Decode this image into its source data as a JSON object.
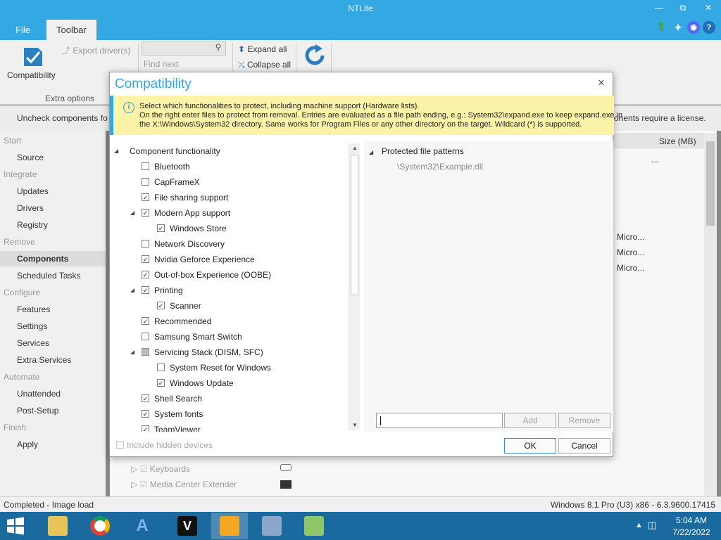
{
  "window": {
    "title": "NTLite"
  },
  "menu": {
    "file": "File",
    "toolbar": "Toolbar"
  },
  "ribbon": {
    "compatibility": "Compatibility",
    "export_drivers": "Export driver(s)",
    "find_next": "Find next",
    "expand_all": "Expand all",
    "collapse_all": "Collapse all",
    "extra_options": "Extra options"
  },
  "infobar": {
    "left": "Uncheck components fo",
    "right": "onents require a license."
  },
  "sidebar": {
    "sections": [
      {
        "label": "Start",
        "items": [
          "Source"
        ]
      },
      {
        "label": "Integrate",
        "items": [
          "Updates",
          "Drivers",
          "Registry"
        ]
      },
      {
        "label": "Remove",
        "items": [
          "Components",
          "Scheduled Tasks"
        ]
      },
      {
        "label": "Configure",
        "items": [
          "Features",
          "Settings",
          "Services",
          "Extra Services"
        ]
      },
      {
        "label": "Automate",
        "items": [
          "Unattended",
          "Post-Setup"
        ]
      },
      {
        "label": "Finish",
        "items": [
          "Apply"
        ]
      }
    ],
    "selected": "Components"
  },
  "grid": {
    "size_header": "Size (MB)",
    "ellipsis": "...",
    "cells": [
      "Micro...",
      "Micro...",
      "Micro..."
    ],
    "bottom_items": [
      "Keyboards",
      "Media Center Extender"
    ]
  },
  "status": {
    "left": "Completed - Image load",
    "right": "Windows 8.1 Pro (U3) x86 - 6.3.9600.17415"
  },
  "taskbar": {
    "time": "5:04 AM",
    "date": "7/22/2022"
  },
  "dialog": {
    "title": "Compatibility",
    "info_lines": [
      "Select which functionalities to protect, including machine support (Hardware lists).",
      "On the right enter files to protect from removal. Entries are evaluated as a file path ending, e.g.: System32\\expand.exe to keep expand.exe in",
      "the X:\\Windows\\System32 directory. Same works for Program Files or any other directory on the target. Wildcard (*) is supported."
    ],
    "tree_root": "Component functionality",
    "tree": [
      {
        "label": "Bluetooth",
        "level": 1,
        "checked": false,
        "expanded": null
      },
      {
        "label": "CapFrameX",
        "level": 1,
        "checked": false,
        "expanded": null
      },
      {
        "label": "File sharing support",
        "level": 1,
        "checked": true,
        "expanded": null
      },
      {
        "label": "Modern App support",
        "level": 1,
        "checked": true,
        "expanded": true
      },
      {
        "label": "Windows Store",
        "level": 2,
        "checked": true,
        "expanded": null
      },
      {
        "label": "Network Discovery",
        "level": 1,
        "checked": false,
        "expanded": null
      },
      {
        "label": "Nvidia Geforce Experience",
        "level": 1,
        "checked": true,
        "expanded": null
      },
      {
        "label": "Out-of-box Experience (OOBE)",
        "level": 1,
        "checked": true,
        "expanded": null
      },
      {
        "label": "Printing",
        "level": 1,
        "checked": true,
        "expanded": true
      },
      {
        "label": "Scanner",
        "level": 2,
        "checked": true,
        "expanded": null
      },
      {
        "label": "Recommended",
        "level": 1,
        "checked": true,
        "expanded": null
      },
      {
        "label": "Samsung Smart Switch",
        "level": 1,
        "checked": false,
        "expanded": null
      },
      {
        "label": "Servicing Stack (DISM, SFC)",
        "level": 1,
        "checked": "partial",
        "expanded": true
      },
      {
        "label": "System Reset for Windows",
        "level": 2,
        "checked": false,
        "expanded": null
      },
      {
        "label": "Windows Update",
        "level": 2,
        "checked": true,
        "expanded": null
      },
      {
        "label": "Shell Search",
        "level": 1,
        "checked": true,
        "expanded": null
      },
      {
        "label": "System fonts",
        "level": 1,
        "checked": true,
        "expanded": null
      },
      {
        "label": "TeamViewer",
        "level": 1,
        "checked": true,
        "expanded": null
      }
    ],
    "protected_header": "Protected file patterns",
    "protected_example": "\\System32\\Example.dll",
    "pattern_input_value": "",
    "add": "Add",
    "remove": "Remove",
    "include_hidden": "Include hidden devices",
    "ok": "OK",
    "cancel": "Cancel"
  },
  "colors": {
    "accent": "#34a8e3",
    "info_bg": "#fbf3a7",
    "taskbar": "#1a6aa0"
  }
}
